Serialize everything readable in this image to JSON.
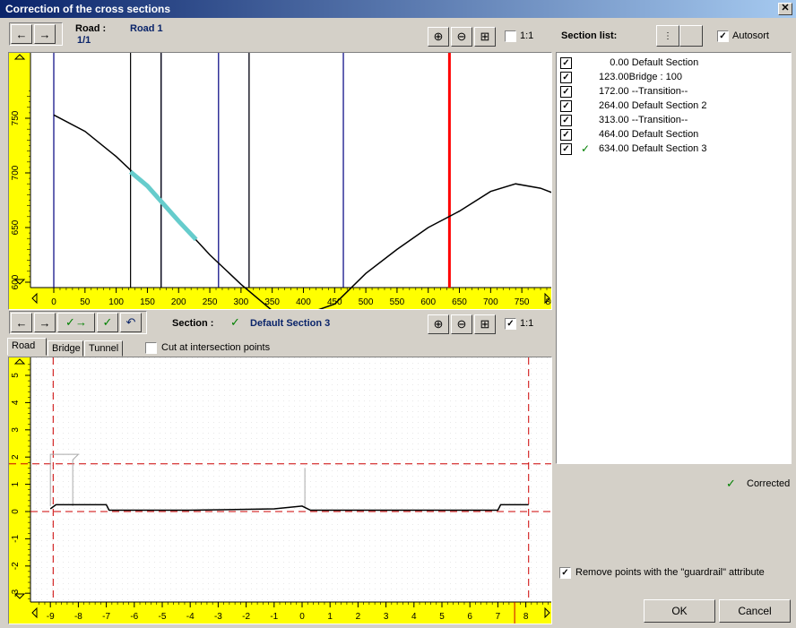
{
  "window": {
    "title": "Correction of the cross sections",
    "close": "✕"
  },
  "top": {
    "road_label": "Road :",
    "road_value": "Road 1",
    "page": "1/1",
    "one_to_one": "1:1",
    "one_to_one_checked": false
  },
  "profile": {
    "x_ticks": [
      "0",
      "50",
      "100",
      "150",
      "200",
      "250",
      "300",
      "350",
      "400",
      "450",
      "500",
      "550",
      "600",
      "650",
      "700",
      "750",
      "800"
    ],
    "y_ticks": [
      "750",
      "700",
      "650",
      "600",
      "550"
    ],
    "section_lines": [
      0,
      172,
      264,
      313,
      464
    ],
    "bridge_lines": [
      123,
      172
    ],
    "current_line": 634
  },
  "section": {
    "label": "Section :",
    "value": "Default Section 3",
    "one_to_one": "1:1",
    "one_to_one_checked": true,
    "tabs": [
      "Road",
      "Bridge",
      "Tunnel"
    ],
    "active_tab": "Road",
    "cut_label": "Cut at intersection points",
    "cut_checked": false,
    "x_ticks": [
      "-9",
      "-8",
      "-7",
      "-6",
      "-5",
      "-4",
      "-3",
      "-2",
      "-1",
      "0",
      "1",
      "2",
      "3",
      "4",
      "5",
      "6",
      "7",
      "8"
    ],
    "y_ticks": [
      "5",
      "4",
      "3",
      "2",
      "1",
      "0",
      "-1",
      "-2",
      "-3"
    ]
  },
  "section_list": {
    "label": "Section list:",
    "autosort_label": "Autosort",
    "autosort_checked": true,
    "items": [
      {
        "text": "    0.00 Default Section",
        "checked": true,
        "corrected": false
      },
      {
        "text": "123.00Bridge : 100",
        "checked": true,
        "corrected": false
      },
      {
        "text": "172.00 --Transition--",
        "checked": true,
        "corrected": false
      },
      {
        "text": "264.00 Default Section 2",
        "checked": true,
        "corrected": false
      },
      {
        "text": "313.00 --Transition--",
        "checked": true,
        "corrected": false
      },
      {
        "text": "464.00 Default Section",
        "checked": true,
        "corrected": false
      },
      {
        "text": "634.00 Default Section 3",
        "checked": true,
        "corrected": true
      }
    ]
  },
  "status": {
    "corrected_label": "Corrected",
    "guardrail_label": "Remove points with the \"guardrail\" attribute",
    "guardrail_checked": true
  },
  "buttons": {
    "ok": "OK",
    "cancel": "Cancel"
  },
  "colors": {
    "accent": "#0a246a",
    "current": "#ff0000",
    "highlight": "#66cccc",
    "ruler": "#ffff00",
    "check_green": "#008000"
  }
}
